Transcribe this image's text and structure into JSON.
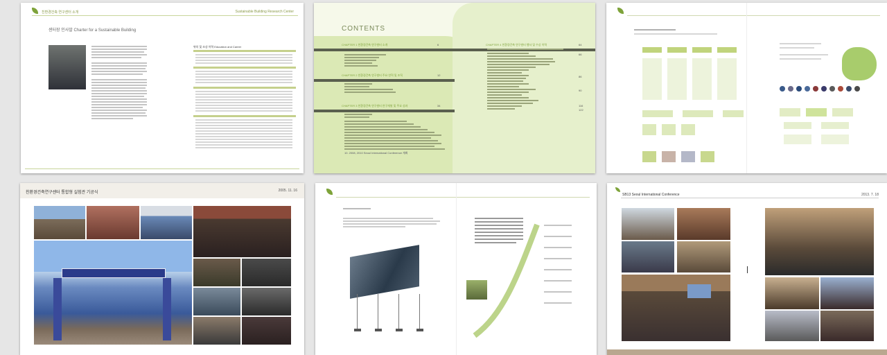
{
  "page1": {
    "header_left": "친환경건축 연구센터 소개",
    "header_right": "Sustainable Building Research Center",
    "title_kr": "센터장 인사말",
    "title_en": "Charter for a Sustainable Building",
    "table_title_kr": "위치 및 조성 이력",
    "table_title_en": "Education and Career"
  },
  "page2": {
    "contents_title": "CONTENTS",
    "chapters": [
      {
        "label": "CHAPTER 1",
        "title": "친환경건축 연구센터 소개",
        "page": "6"
      },
      {
        "label": "CHAPTER 2",
        "title": "친환경건축 연구센터 주요 연혁 및 조직",
        "page": "12"
      },
      {
        "label": "CHAPTER 3",
        "title": "친환경건축 연구센터 연구개발 및 주요 성과",
        "page": "34"
      },
      {
        "label": "CHAPTER 4",
        "title": "친환경건축 연구센터 행사 및 수상 이력",
        "page": "64"
      }
    ],
    "right_pages": [
      "66",
      "86",
      "90",
      "116",
      "122"
    ],
    "bottom_note": "10. 2008, 2010 Seoul International Conference 개최"
  },
  "page4": {
    "header": "친환경건축연구센터 통합형 실험관 기공식",
    "date": "2005. 11. 16"
  },
  "page6": {
    "header": "SB13 Seoul International Conference",
    "date": "2013. 7. 18"
  },
  "colors": {
    "accent_green": "#7ea33a",
    "light_green": "#dbe9b5",
    "bg": "#e6e6e6"
  }
}
